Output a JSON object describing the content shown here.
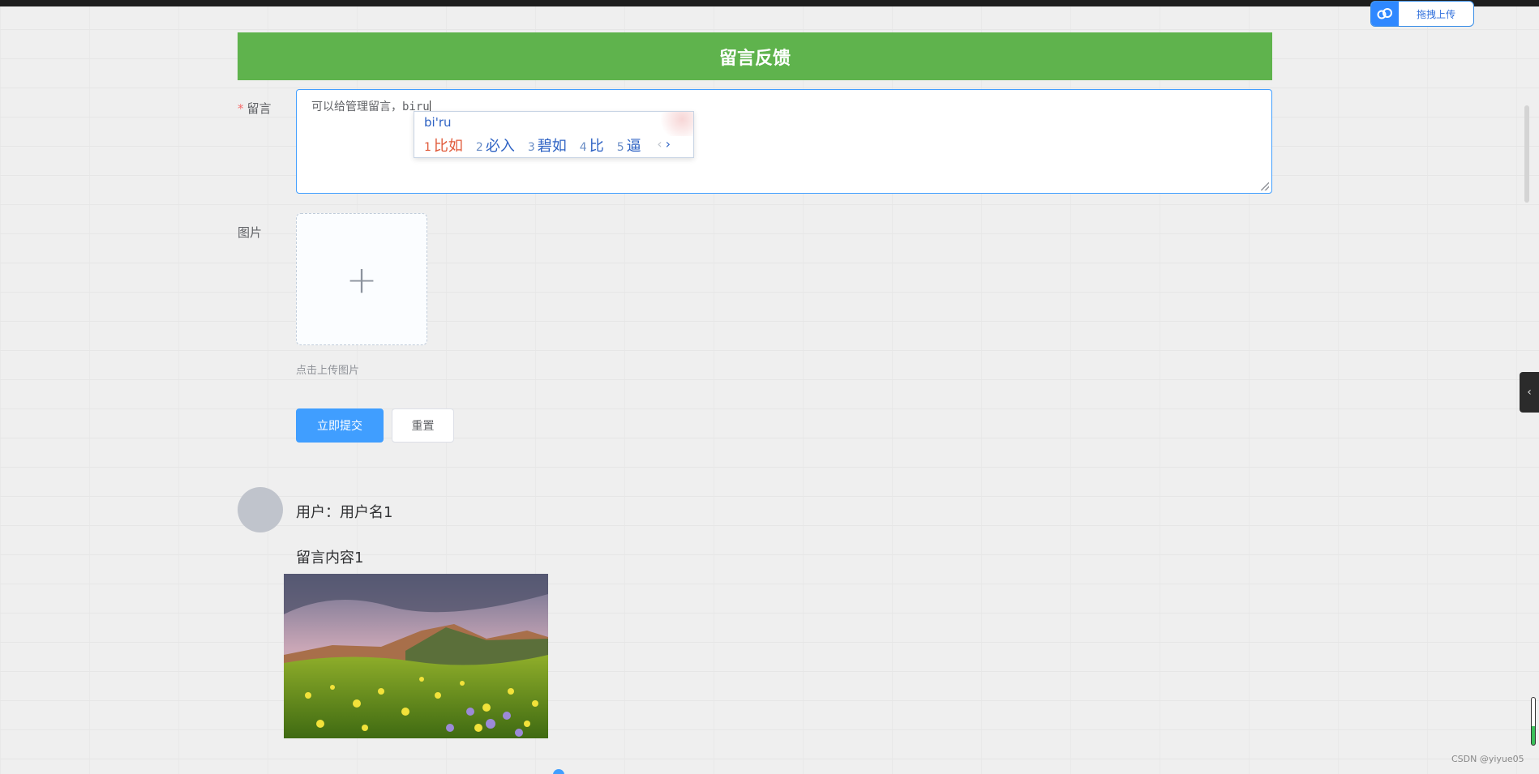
{
  "upload_widget": {
    "icon": "cloud-icon",
    "label": "拖拽上传"
  },
  "header": {
    "title": "留言反馈"
  },
  "form": {
    "message_label": "留言",
    "required_mark": "*",
    "message_value": "可以给管理留言，biru",
    "image_label": "图片",
    "upload_icon": "plus-icon",
    "upload_plus": "+",
    "upload_hint": "点击上传图片",
    "submit_label": "立即提交",
    "reset_label": "重置"
  },
  "ime": {
    "pinyin": "bi'ru",
    "candidates": [
      {
        "num": "1",
        "word": "比如"
      },
      {
        "num": "2",
        "word": "必入"
      },
      {
        "num": "3",
        "word": "碧如"
      },
      {
        "num": "4",
        "word": "比"
      },
      {
        "num": "5",
        "word": "逼"
      }
    ],
    "prev": "‹",
    "next": "›"
  },
  "comment": {
    "user": "用户：用户名1",
    "content": "留言内容1"
  },
  "sidebar_toggle": {
    "icon": "chevron-left-icon",
    "glyph": "‹"
  },
  "watermark": "CSDN @yiyue05"
}
